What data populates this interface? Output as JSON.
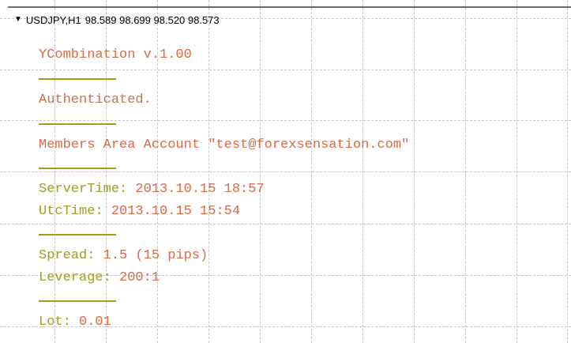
{
  "header": {
    "collapse_icon": "triangle-down-icon",
    "symbol": "USDJPY,H1",
    "ohlc": "98.589 98.699 98.520 98.573"
  },
  "overlay": {
    "title": "YCombination v.1.00",
    "status": "Authenticated.",
    "account": "Members Area Account \"test@forexsensation.com\"",
    "server_time_label": "ServerTime:",
    "server_time_value": "2013.10.15 18:57",
    "utc_time_label": "UtcTime:",
    "utc_time_value": "2013.10.15 15:54",
    "spread_label": "Spread:",
    "spread_value": "1.5 (15 pips)",
    "leverage_label": "Leverage:",
    "leverage_value": "200:1",
    "lot_label": "Lot:",
    "lot_value": "0.01"
  },
  "colors": {
    "label": "#a29d1d",
    "value": "#d76b48",
    "grid": "#c6c6c6",
    "background": "#ffffff"
  }
}
